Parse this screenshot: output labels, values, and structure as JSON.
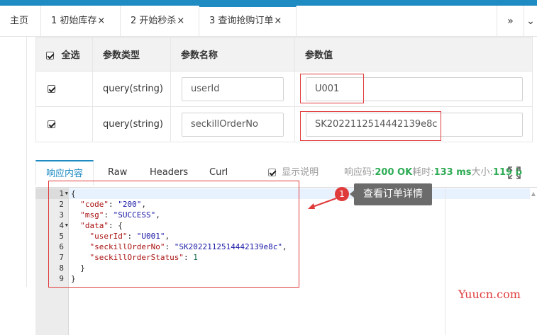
{
  "tabs": [
    {
      "label": "主页",
      "close": ""
    },
    {
      "label": "1 初始库存",
      "close": "×"
    },
    {
      "label": "2 开始秒杀",
      "close": "×"
    },
    {
      "label": "3 查询抢购订单",
      "close": "×"
    }
  ],
  "tab_nav": {
    "next_glyph": "»",
    "extra_glyph": "⌄"
  },
  "params_table": {
    "headers": {
      "select_all": "全选",
      "type": "参数类型",
      "name": "参数名称",
      "value": "参数值"
    },
    "rows": [
      {
        "type": "query(string)",
        "name": "userId",
        "value": "U001"
      },
      {
        "type": "query(string)",
        "name": "seckillOrderNo",
        "value": "SK2022112514442139e8c"
      }
    ]
  },
  "response_tabs": [
    "响应内容",
    "Raw",
    "Headers",
    "Curl"
  ],
  "response_meta": {
    "show_desc": "显示说明",
    "code_label": "响应码:",
    "code_value": "200 OK",
    "time_label": "耗时:",
    "time_value": "133 ms",
    "size_label": "大小:",
    "size_value": "119 b"
  },
  "editor": {
    "line_numbers": [
      "1",
      "2",
      "3",
      "4",
      "5",
      "6",
      "7",
      "8",
      "9"
    ],
    "lines": [
      "{",
      "  \"code\": \"200\",",
      "  \"msg\": \"SUCCESS\",",
      "  \"data\": {",
      "    \"userId\": \"U001\",",
      "    \"seckillOrderNo\": \"SK2022112514442139e8c\",",
      "    \"seckillOrderStatus\": 1",
      "  }",
      "}"
    ]
  },
  "annotation": {
    "badge": "1",
    "tooltip": "查看订单详情"
  },
  "watermark": "Yuucn.com",
  "colors": {
    "accent": "#1e8bc3",
    "success": "#2eab55",
    "annotation_red": "#e03b3b"
  }
}
